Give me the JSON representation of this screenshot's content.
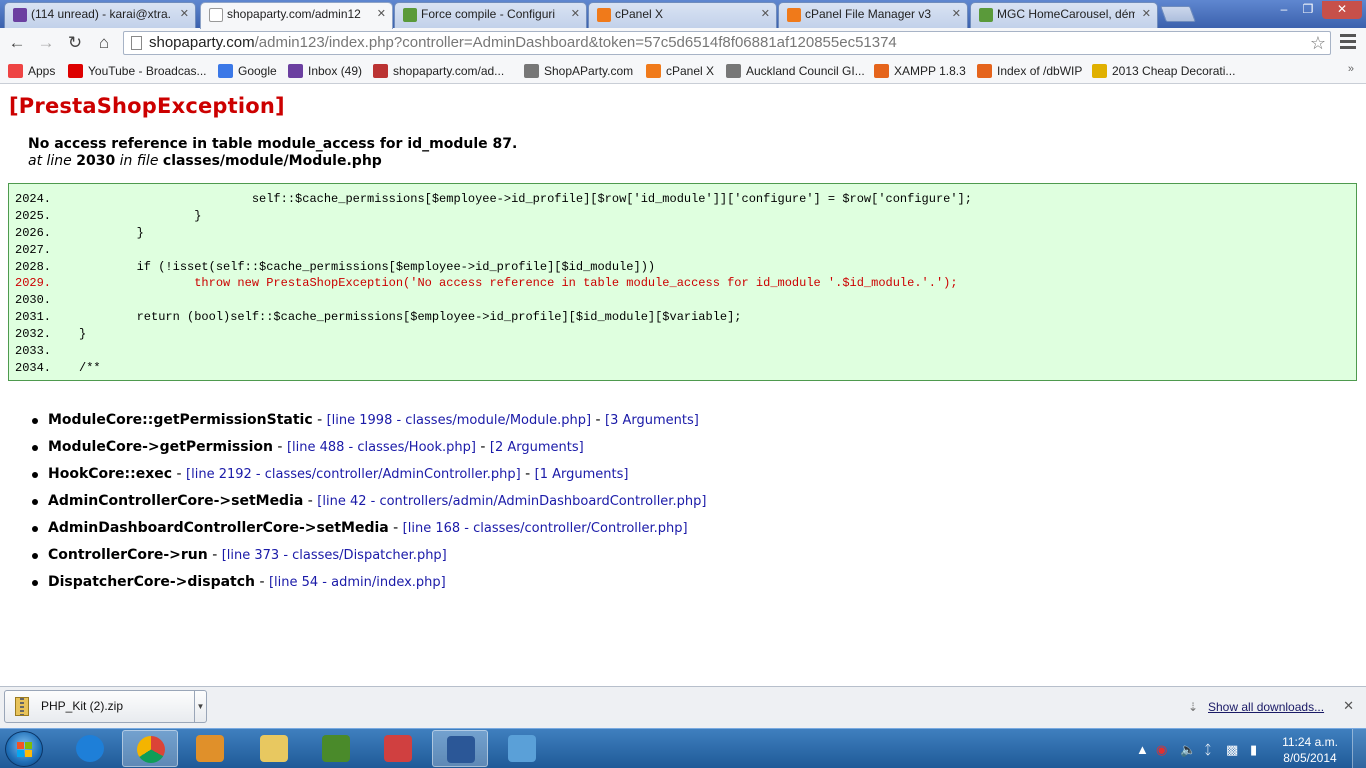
{
  "browser": {
    "tabs": [
      {
        "label": "(114 unread) - karai@xtra.",
        "icon": "mail-icon",
        "color": "#6b3fa0"
      },
      {
        "label": "shopaparty.com/admin12",
        "icon": "page-icon",
        "color": "#ffffff"
      },
      {
        "label": "Force compile - Configuri",
        "icon": "puzzle-icon",
        "color": "#5a9a3a"
      },
      {
        "label": "cPanel X",
        "icon": "cpanel-icon",
        "color": "#f07a1a"
      },
      {
        "label": "cPanel File Manager v3",
        "icon": "cpanel-icon",
        "color": "#f07a1a"
      },
      {
        "label": "MGC HomeCarousel, dém",
        "icon": "puzzle-icon",
        "color": "#5a9a3a"
      }
    ],
    "url_host": "shopaparty.com",
    "url_path": "/admin123/index.php?controller=AdminDashboard&token=57c5d6514f8f06881af120855ec51374",
    "bookmarks": [
      {
        "label": "Apps",
        "icon": "apps-grid-icon",
        "color": "#e44"
      },
      {
        "label": "YouTube - Broadcas...",
        "icon": "youtube-icon",
        "color": "#d00"
      },
      {
        "label": "Google",
        "icon": "google-icon",
        "color": "#3b78e7"
      },
      {
        "label": "Inbox (49)",
        "icon": "mail-icon",
        "color": "#6b3fa0"
      },
      {
        "label": "shopaparty.com/ad...",
        "icon": "shop-icon",
        "color": "#b33"
      },
      {
        "label": "ShopAParty.com",
        "icon": "page-icon",
        "color": "#777"
      },
      {
        "label": "cPanel X",
        "icon": "cpanel-icon",
        "color": "#f07a1a"
      },
      {
        "label": "Auckland Council GI...",
        "icon": "page-icon",
        "color": "#777"
      },
      {
        "label": "XAMPP 1.8.3",
        "icon": "xampp-icon",
        "color": "#e5641c"
      },
      {
        "label": "Index of /dbWIP",
        "icon": "xampp-icon",
        "color": "#e5641c"
      },
      {
        "label": "2013 Cheap Decorati...",
        "icon": "party-icon",
        "color": "#e0b000"
      }
    ]
  },
  "exception": {
    "title": "[PrestaShopException]",
    "message": "No access reference in table module_access for id_module 87.",
    "at_line_prefix": "at line",
    "line_number": "2030",
    "in_file_prefix": "in file",
    "file": "classes/module/Module.php"
  },
  "code_lines": [
    {
      "num": "2024.",
      "text": "                        self::$cache_permissions[$employee->id_profile][$row['id_module']]['configure'] = $row['configure'];",
      "error": false
    },
    {
      "num": "2025.",
      "text": "                }",
      "error": false
    },
    {
      "num": "2026.",
      "text": "        }",
      "error": false
    },
    {
      "num": "2027.",
      "text": "",
      "error": false
    },
    {
      "num": "2028.",
      "text": "        if (!isset(self::$cache_permissions[$employee->id_profile][$id_module]))",
      "error": false
    },
    {
      "num": "2029.",
      "text": "                throw new PrestaShopException('No access reference in table module_access for id_module '.$id_module.'.');",
      "error": true
    },
    {
      "num": "2030.",
      "text": "",
      "error": false
    },
    {
      "num": "2031.",
      "text": "        return (bool)self::$cache_permissions[$employee->id_profile][$id_module][$variable];",
      "error": false
    },
    {
      "num": "2032.",
      "text": "}",
      "error": false
    },
    {
      "num": "2033.",
      "text": "",
      "error": false
    },
    {
      "num": "2034.",
      "text": "/**",
      "error": false
    }
  ],
  "trace": [
    {
      "fn": "ModuleCore::getPermissionStatic",
      "loc": "[line 1998 - classes/module/Module.php]",
      "args": "[3 Arguments]"
    },
    {
      "fn": "ModuleCore->getPermission",
      "loc": "[line 488 - classes/Hook.php]",
      "args": "[2 Arguments]"
    },
    {
      "fn": "HookCore::exec",
      "loc": "[line 2192 - classes/controller/AdminController.php]",
      "args": "[1 Arguments]"
    },
    {
      "fn": "AdminControllerCore->setMedia",
      "loc": "[line 42 - controllers/admin/AdminDashboardController.php]",
      "args": ""
    },
    {
      "fn": "AdminDashboardControllerCore->setMedia",
      "loc": "[line 168 - classes/controller/Controller.php]",
      "args": ""
    },
    {
      "fn": "ControllerCore->run",
      "loc": "[line 373 - classes/Dispatcher.php]",
      "args": ""
    },
    {
      "fn": "DispatcherCore->dispatch",
      "loc": "[line 54 - admin/index.php]",
      "args": ""
    }
  ],
  "downloads": {
    "file": "PHP_Kit (2).zip",
    "show_all": "Show all downloads..."
  },
  "taskbar": {
    "apps": [
      {
        "name": "internet-explorer-icon",
        "color": "#1e7fd8"
      },
      {
        "name": "chrome-icon",
        "color": "#e04a3a"
      },
      {
        "name": "media-player-icon",
        "color": "#e0902a"
      },
      {
        "name": "file-explorer-icon",
        "color": "#e8c860"
      },
      {
        "name": "project-icon",
        "color": "#4a8a2a"
      },
      {
        "name": "apps-grid-icon",
        "color": "#d04040"
      },
      {
        "name": "word-icon",
        "color": "#2b5797"
      },
      {
        "name": "paint-icon",
        "color": "#5aa0d8"
      }
    ],
    "time": "11:24 a.m.",
    "date": "8/05/2014"
  }
}
